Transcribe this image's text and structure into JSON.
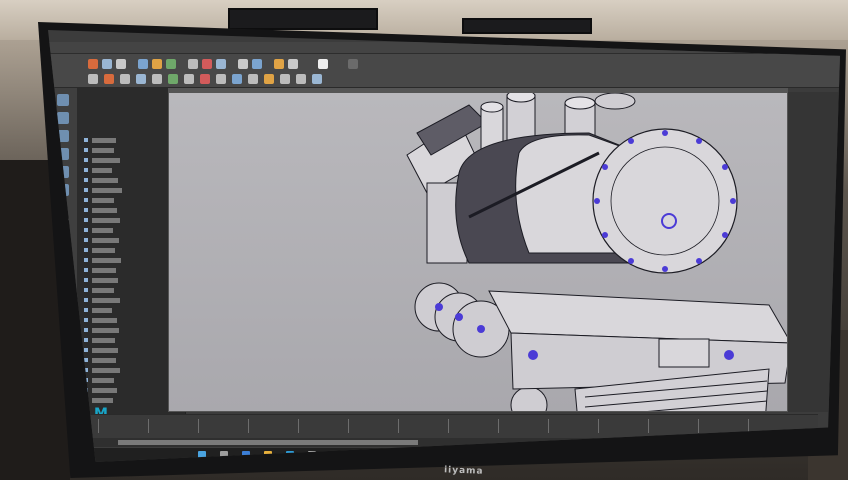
{
  "photo": {
    "brand_label": "iiyama",
    "app_logo": "M"
  },
  "maya": {
    "palette": {
      "panel": "#3c3c3c",
      "viewport": "#b0afb4",
      "model_fill": "#d9d7db",
      "model_shadow": "#4a4852",
      "model_edges": "#1c1c24",
      "selection_verts": "#4b3bd6",
      "accent_icon": "#19a6c8"
    }
  }
}
